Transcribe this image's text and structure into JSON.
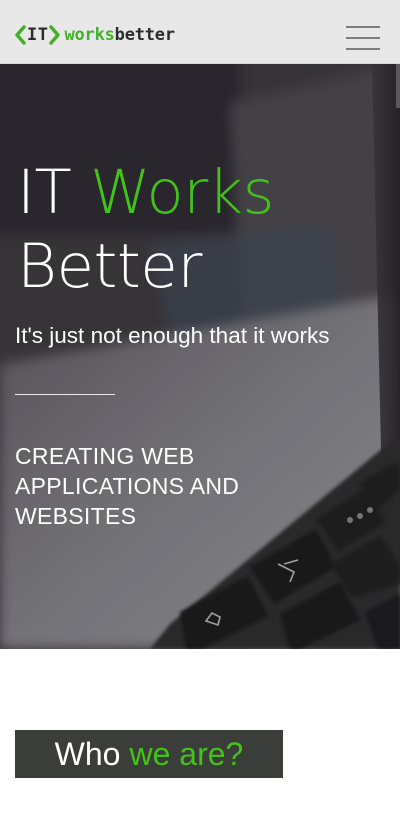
{
  "header": {
    "logo": {
      "bracket_text": "IT",
      "text_part1": "works",
      "text_part2": "better"
    },
    "menu_icon": "hamburger-menu-icon"
  },
  "hero": {
    "title_part1": "IT",
    "title_part2": "Works",
    "title_part3": "Better",
    "subtitle": "It's just not enough that it works",
    "tagline": "CREATING WEB APPLICATIONS AND WEBSITES",
    "background": "laptop-keyboard-photo"
  },
  "who_section": {
    "heading_part1": "Who",
    "heading_part2": "we are?"
  },
  "colors": {
    "accent": "#43c21a",
    "header_bg": "#e8e8e8",
    "dark_box": "#3a3d39"
  }
}
